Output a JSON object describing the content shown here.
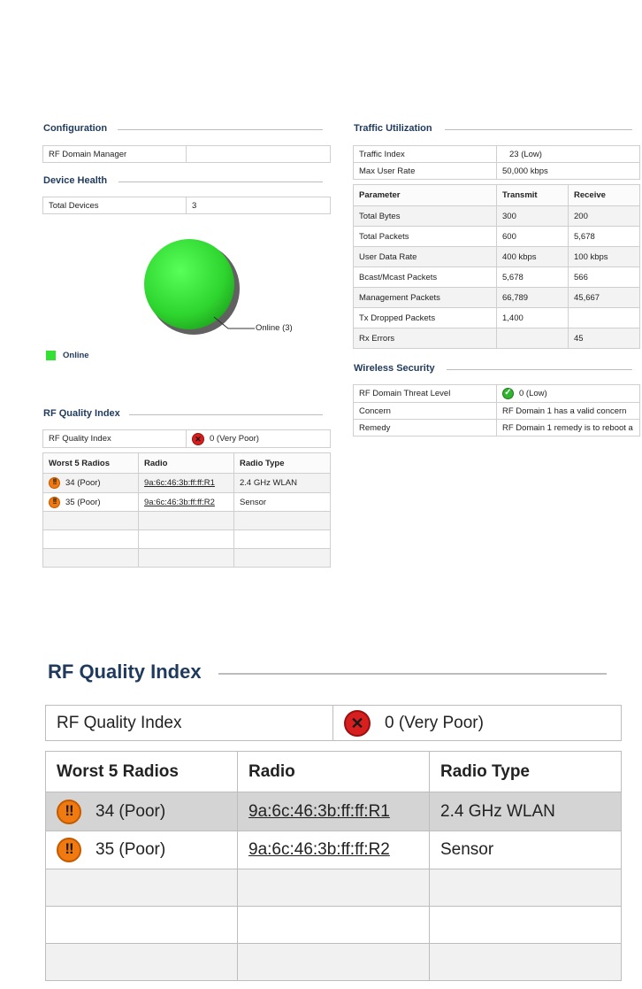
{
  "configuration": {
    "title": "Configuration",
    "rf_domain_manager_label": "RF Domain Manager",
    "rf_domain_manager_value": ""
  },
  "device_health": {
    "title": "Device Health",
    "total_devices_label": "Total Devices",
    "total_devices_value": "3",
    "chart_label": "Online (3)",
    "legend_label": "Online",
    "online_color": "#33e033"
  },
  "rf_quality": {
    "title": "RF Quality Index",
    "index_label": "RF Quality Index",
    "index_value": "0 (Very Poor)",
    "index_icon": "x-circle-icon",
    "columns": [
      "Worst 5 Radios",
      "Radio",
      "Radio Type"
    ],
    "rows": [
      {
        "quality": "34 (Poor)",
        "radio": "9a:6c:46:3b:ff:ff:R1",
        "type": "2.4 GHz WLAN",
        "icon": "warning-icon"
      },
      {
        "quality": "35 (Poor)",
        "radio": "9a:6c:46:3b:ff:ff:R2",
        "type": "Sensor",
        "icon": "warning-icon"
      }
    ]
  },
  "traffic": {
    "title": "Traffic Utilization",
    "traffic_index_label": "Traffic Index",
    "traffic_index_value": "23 (Low)",
    "max_user_rate_label": "Max User Rate",
    "max_user_rate_value": "50,000 kbps",
    "columns": [
      "Parameter",
      "Transmit",
      "Receive"
    ],
    "rows": [
      {
        "param": "Total Bytes",
        "tx": "300",
        "rx": "200"
      },
      {
        "param": "Total Packets",
        "tx": "600",
        "rx": "5,678"
      },
      {
        "param": "User Data Rate",
        "tx": "400 kbps",
        "rx": "100 kbps"
      },
      {
        "param": "Bcast/Mcast Packets",
        "tx": "5,678",
        "rx": "566"
      },
      {
        "param": "Management Packets",
        "tx": "66,789",
        "rx": "45,667"
      },
      {
        "param": "Tx Dropped Packets",
        "tx": "1,400",
        "rx": ""
      },
      {
        "param": "Rx Errors",
        "tx": "",
        "rx": "45"
      }
    ]
  },
  "security": {
    "title": "Wireless Security",
    "threat_label": "RF Domain Threat Level",
    "threat_value": "0 (Low)",
    "threat_icon": "check-circle-icon",
    "concern_label": "Concern",
    "concern_value": "RF Domain 1 has a valid concern",
    "remedy_label": "Remedy",
    "remedy_value": "RF Domain 1 remedy is to reboot a"
  }
}
